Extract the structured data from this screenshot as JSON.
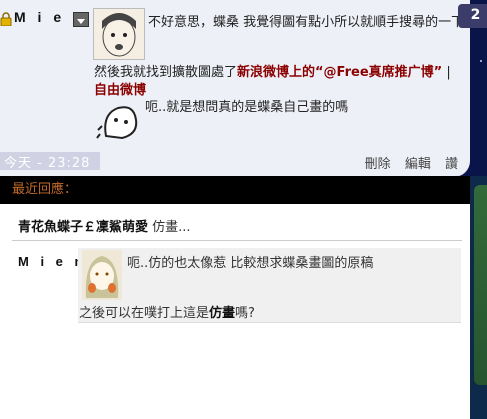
{
  "post": {
    "author": "M i e m",
    "line1": "不好意思，蝶桑 我覺得圖有點小所以就順手搜尋的一下 記起",
    "badge": "2",
    "line2_prefix": "然後我就找到擴散圖處了",
    "line2_link": "新浪微博上的“@Free真席推广博”",
    "line2_suffix": " |",
    "line3": "自由微博",
    "line4": "呃..就是想問真的是蝶桑自己畫的嗎",
    "time": "今天 - 23:28",
    "actions": [
      "刪除",
      "編輯",
      "讚"
    ]
  },
  "responses": {
    "header": "最近回應：",
    "quote_author": "青花魚蝶子￡凜鯊萌愛",
    "quote_text": " 仿畫...",
    "reply_author": "M i e m",
    "reply_line1": "呃..仿的也太像惹 比較想求蝶桑畫圖的原稿",
    "reply_line2_prefix": "之後可以在噗打上這是",
    "reply_line2_bold": "仿畫",
    "reply_line2_suffix": "嗎?"
  },
  "icons": {
    "lock": "lock-icon",
    "dropdown": "chevron-down-icon"
  },
  "colors": {
    "link": "#8b0000",
    "header_text": "#c36b2a",
    "background": "#0d1a5e"
  }
}
